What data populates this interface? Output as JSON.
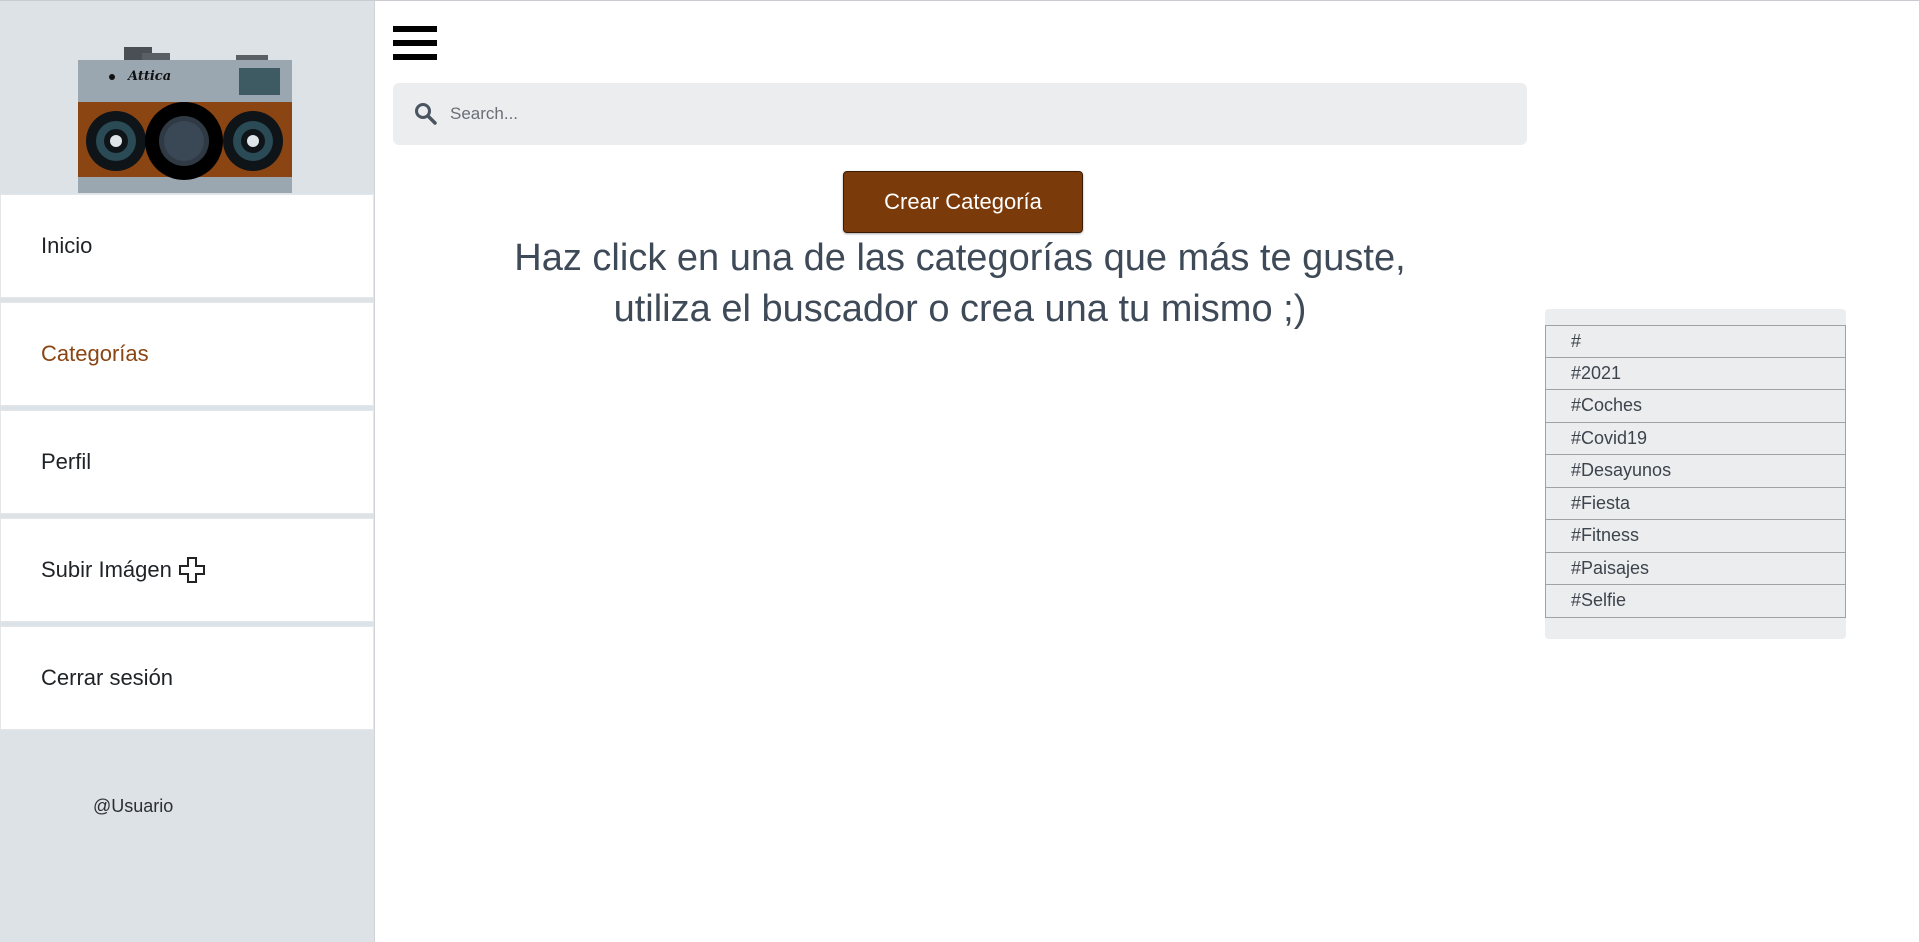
{
  "sidebar": {
    "logo_text": "Attica",
    "nav": [
      {
        "label": "Inicio"
      },
      {
        "label": "Categorías"
      },
      {
        "label": "Perfil"
      },
      {
        "label": "Subir Imágen"
      },
      {
        "label": "Cerrar sesión"
      }
    ],
    "active_index": 1,
    "username": "@Usuario"
  },
  "search": {
    "placeholder": "Search...",
    "value": ""
  },
  "main": {
    "create_button_label": "Crear Categoría",
    "instructions_line1": "Haz click en una de las categorías que más te guste,",
    "instructions_line2": "utiliza el buscador o crea una tu mismo ;)"
  },
  "tags": [
    "#",
    "#2021",
    "#Coches",
    "#Covid19",
    "#Desayunos",
    "#Fiesta",
    "#Fitness",
    "#Paisajes",
    "#Selfie"
  ],
  "icons": {
    "menu": "hamburger-menu-icon",
    "search": "search-icon",
    "upload": "plus-icon",
    "logo": "camera-logo"
  },
  "colors": {
    "accent": "#7b3a09",
    "active_nav": "#8b4513",
    "sidebar_bg": "#dde2e6",
    "panel_bg": "#ebedef",
    "text_heading": "#3e4a57"
  }
}
